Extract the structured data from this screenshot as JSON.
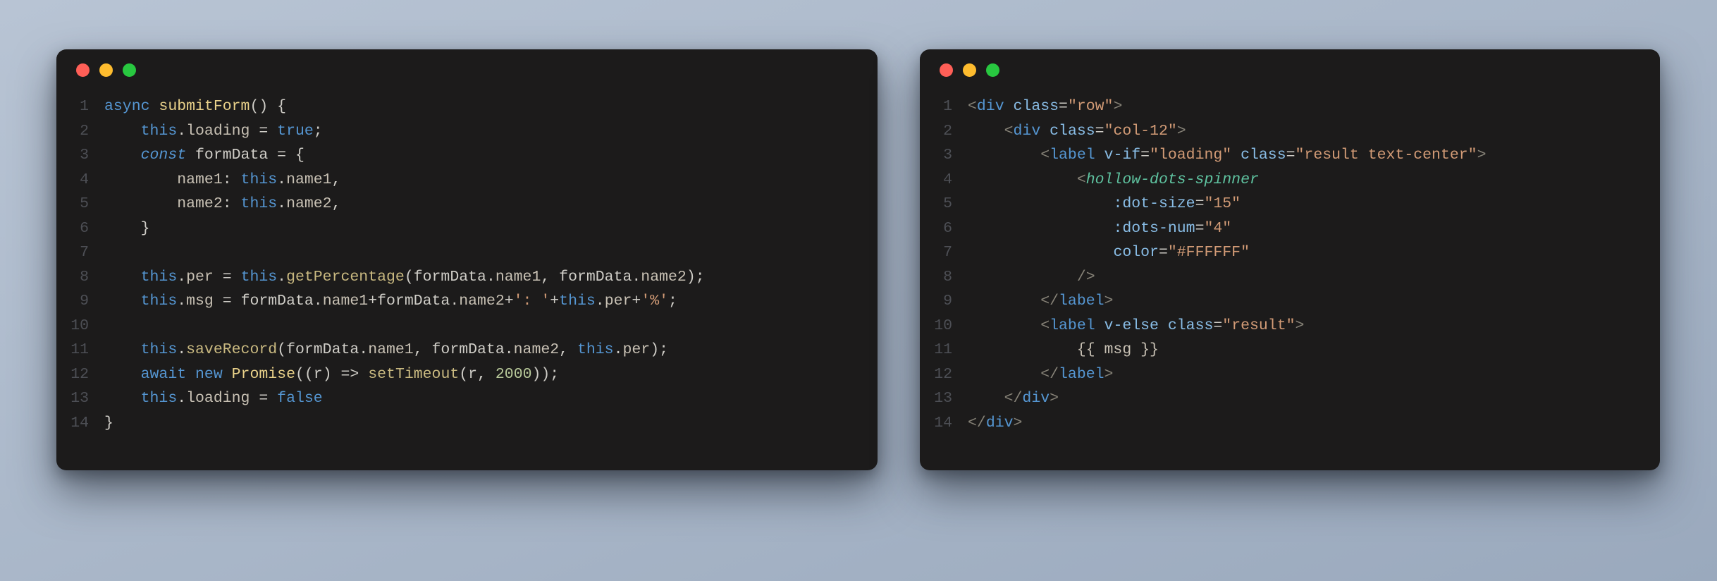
{
  "windows": [
    {
      "id": "js",
      "traffic": {
        "close": "#ff5f57",
        "min": "#febc2e",
        "zoom": "#28c840"
      },
      "lines": 14,
      "code": {
        "1": {
          "indent": 0,
          "tokens": [
            [
              "key",
              "async"
            ],
            [
              "sp",
              " "
            ],
            [
              "fn",
              "submitForm"
            ],
            [
              "punct",
              "()"
            ],
            [
              "sp",
              " "
            ],
            [
              "punct",
              "{"
            ]
          ]
        },
        "2": {
          "indent": 4,
          "tokens": [
            [
              "key",
              "this"
            ],
            [
              "punct",
              "."
            ],
            [
              "prop",
              "loading"
            ],
            [
              "sp",
              " "
            ],
            [
              "op",
              "="
            ],
            [
              "sp",
              " "
            ],
            [
              "bool",
              "true"
            ],
            [
              "punct",
              ";"
            ]
          ]
        },
        "3": {
          "indent": 4,
          "tokens": [
            [
              "key-it",
              "const"
            ],
            [
              "sp",
              " "
            ],
            [
              "ident",
              "formData"
            ],
            [
              "sp",
              " "
            ],
            [
              "op",
              "="
            ],
            [
              "sp",
              " "
            ],
            [
              "punct",
              "{"
            ]
          ]
        },
        "4": {
          "indent": 8,
          "tokens": [
            [
              "prop",
              "name1"
            ],
            [
              "punct",
              ":"
            ],
            [
              "sp",
              " "
            ],
            [
              "key",
              "this"
            ],
            [
              "punct",
              "."
            ],
            [
              "prop",
              "name1"
            ],
            [
              "punct",
              ","
            ]
          ]
        },
        "5": {
          "indent": 8,
          "tokens": [
            [
              "prop",
              "name2"
            ],
            [
              "punct",
              ":"
            ],
            [
              "sp",
              " "
            ],
            [
              "key",
              "this"
            ],
            [
              "punct",
              "."
            ],
            [
              "prop",
              "name2"
            ],
            [
              "punct",
              ","
            ]
          ]
        },
        "6": {
          "indent": 4,
          "tokens": [
            [
              "punct",
              "}"
            ]
          ]
        },
        "7": {
          "indent": 0,
          "tokens": []
        },
        "8": {
          "indent": 4,
          "tokens": [
            [
              "key",
              "this"
            ],
            [
              "punct",
              "."
            ],
            [
              "prop",
              "per"
            ],
            [
              "sp",
              " "
            ],
            [
              "op",
              "="
            ],
            [
              "sp",
              " "
            ],
            [
              "key",
              "this"
            ],
            [
              "punct",
              "."
            ],
            [
              "call",
              "getPercentage"
            ],
            [
              "punct",
              "("
            ],
            [
              "ident",
              "formData"
            ],
            [
              "punct",
              "."
            ],
            [
              "prop",
              "name1"
            ],
            [
              "punct",
              ","
            ],
            [
              "sp",
              " "
            ],
            [
              "ident",
              "formData"
            ],
            [
              "punct",
              "."
            ],
            [
              "prop",
              "name2"
            ],
            [
              "punct",
              ");"
            ]
          ]
        },
        "9": {
          "indent": 4,
          "tokens": [
            [
              "key",
              "this"
            ],
            [
              "punct",
              "."
            ],
            [
              "prop",
              "msg"
            ],
            [
              "sp",
              " "
            ],
            [
              "op",
              "="
            ],
            [
              "sp",
              " "
            ],
            [
              "ident",
              "formData"
            ],
            [
              "punct",
              "."
            ],
            [
              "prop",
              "name1"
            ],
            [
              "op",
              "+"
            ],
            [
              "ident",
              "formData"
            ],
            [
              "punct",
              "."
            ],
            [
              "prop",
              "name2"
            ],
            [
              "op",
              "+"
            ],
            [
              "str",
              "': '"
            ],
            [
              "op",
              "+"
            ],
            [
              "key",
              "this"
            ],
            [
              "punct",
              "."
            ],
            [
              "prop",
              "per"
            ],
            [
              "op",
              "+"
            ],
            [
              "str",
              "'%'"
            ],
            [
              "punct",
              ";"
            ]
          ]
        },
        "10": {
          "indent": 0,
          "tokens": []
        },
        "11": {
          "indent": 4,
          "tokens": [
            [
              "key",
              "this"
            ],
            [
              "punct",
              "."
            ],
            [
              "call",
              "saveRecord"
            ],
            [
              "punct",
              "("
            ],
            [
              "ident",
              "formData"
            ],
            [
              "punct",
              "."
            ],
            [
              "prop",
              "name1"
            ],
            [
              "punct",
              ","
            ],
            [
              "sp",
              " "
            ],
            [
              "ident",
              "formData"
            ],
            [
              "punct",
              "."
            ],
            [
              "prop",
              "name2"
            ],
            [
              "punct",
              ","
            ],
            [
              "sp",
              " "
            ],
            [
              "key",
              "this"
            ],
            [
              "punct",
              "."
            ],
            [
              "prop",
              "per"
            ],
            [
              "punct",
              ");"
            ]
          ]
        },
        "12": {
          "indent": 4,
          "tokens": [
            [
              "key",
              "await"
            ],
            [
              "sp",
              " "
            ],
            [
              "key",
              "new"
            ],
            [
              "sp",
              " "
            ],
            [
              "fn",
              "Promise"
            ],
            [
              "punct",
              "(("
            ],
            [
              "ident",
              "r"
            ],
            [
              "punct",
              ")"
            ],
            [
              "sp",
              " "
            ],
            [
              "op",
              "=>"
            ],
            [
              "sp",
              " "
            ],
            [
              "call",
              "setTimeout"
            ],
            [
              "punct",
              "("
            ],
            [
              "ident",
              "r"
            ],
            [
              "punct",
              ","
            ],
            [
              "sp",
              " "
            ],
            [
              "num",
              "2000"
            ],
            [
              "punct",
              "));"
            ]
          ]
        },
        "13": {
          "indent": 4,
          "tokens": [
            [
              "key",
              "this"
            ],
            [
              "punct",
              "."
            ],
            [
              "prop",
              "loading"
            ],
            [
              "sp",
              " "
            ],
            [
              "op",
              "="
            ],
            [
              "sp",
              " "
            ],
            [
              "bool",
              "false"
            ]
          ]
        },
        "14": {
          "indent": 0,
          "tokens": [
            [
              "punct",
              "}"
            ]
          ]
        }
      }
    },
    {
      "id": "html",
      "traffic": {
        "close": "#ff5f57",
        "min": "#febc2e",
        "zoom": "#28c840"
      },
      "lines": 14,
      "code": {
        "1": {
          "indent": 0,
          "tokens": [
            [
              "tag-br",
              "<"
            ],
            [
              "tag",
              "div"
            ],
            [
              "sp",
              " "
            ],
            [
              "attr",
              "class"
            ],
            [
              "eq",
              "="
            ],
            [
              "str",
              "\"row\""
            ],
            [
              "tag-br",
              ">"
            ]
          ]
        },
        "2": {
          "indent": 4,
          "tokens": [
            [
              "tag-br",
              "<"
            ],
            [
              "tag",
              "div"
            ],
            [
              "sp",
              " "
            ],
            [
              "attr",
              "class"
            ],
            [
              "eq",
              "="
            ],
            [
              "str",
              "\"col-12\""
            ],
            [
              "tag-br",
              ">"
            ]
          ]
        },
        "3": {
          "indent": 8,
          "tokens": [
            [
              "tag-br",
              "<"
            ],
            [
              "tag",
              "label"
            ],
            [
              "sp",
              " "
            ],
            [
              "attr",
              "v-if"
            ],
            [
              "eq",
              "="
            ],
            [
              "str",
              "\"loading\""
            ],
            [
              "sp",
              " "
            ],
            [
              "attr",
              "class"
            ],
            [
              "eq",
              "="
            ],
            [
              "str",
              "\"result text-center\""
            ],
            [
              "tag-br",
              ">"
            ]
          ]
        },
        "4": {
          "indent": 12,
          "tokens": [
            [
              "tag-br",
              "<"
            ],
            [
              "type",
              "hollow-dots-spinner"
            ]
          ]
        },
        "5": {
          "indent": 16,
          "tokens": [
            [
              "attr",
              ":dot-size"
            ],
            [
              "eq",
              "="
            ],
            [
              "str",
              "\"15\""
            ]
          ]
        },
        "6": {
          "indent": 16,
          "tokens": [
            [
              "attr",
              ":dots-num"
            ],
            [
              "eq",
              "="
            ],
            [
              "str",
              "\"4\""
            ]
          ]
        },
        "7": {
          "indent": 16,
          "tokens": [
            [
              "attr",
              "color"
            ],
            [
              "eq",
              "="
            ],
            [
              "str",
              "\"#FFFFFF\""
            ]
          ]
        },
        "8": {
          "indent": 12,
          "tokens": [
            [
              "tag-br",
              "/>"
            ]
          ]
        },
        "9": {
          "indent": 8,
          "tokens": [
            [
              "tag-br",
              "</"
            ],
            [
              "tag",
              "label"
            ],
            [
              "tag-br",
              ">"
            ]
          ]
        },
        "10": {
          "indent": 8,
          "tokens": [
            [
              "tag-br",
              "<"
            ],
            [
              "tag",
              "label"
            ],
            [
              "sp",
              " "
            ],
            [
              "attr",
              "v-else"
            ],
            [
              "sp",
              " "
            ],
            [
              "attr",
              "class"
            ],
            [
              "eq",
              "="
            ],
            [
              "str",
              "\"result\""
            ],
            [
              "tag-br",
              ">"
            ]
          ]
        },
        "11": {
          "indent": 12,
          "tokens": [
            [
              "attr2",
              "{{ msg }}"
            ]
          ]
        },
        "12": {
          "indent": 8,
          "tokens": [
            [
              "tag-br",
              "</"
            ],
            [
              "tag",
              "label"
            ],
            [
              "tag-br",
              ">"
            ]
          ]
        },
        "13": {
          "indent": 4,
          "tokens": [
            [
              "tag-br",
              "</"
            ],
            [
              "tag",
              "div"
            ],
            [
              "tag-br",
              ">"
            ]
          ]
        },
        "14": {
          "indent": 0,
          "tokens": [
            [
              "tag-br",
              "</"
            ],
            [
              "tag",
              "div"
            ],
            [
              "tag-br",
              ">"
            ]
          ]
        }
      }
    }
  ]
}
